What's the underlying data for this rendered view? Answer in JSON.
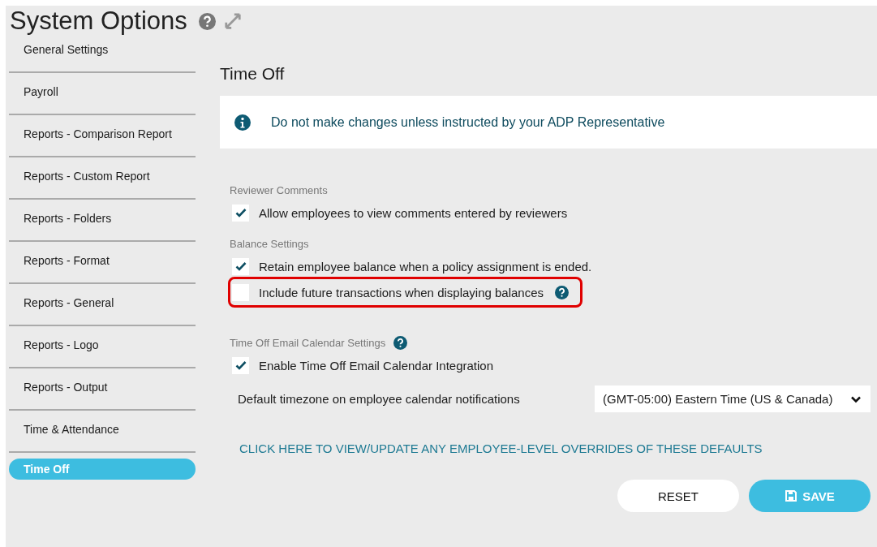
{
  "title": "System Options",
  "sidebar": {
    "items": [
      {
        "label": "General Settings",
        "selected": false
      },
      {
        "label": "Payroll",
        "selected": false
      },
      {
        "label": "Reports - Comparison Report",
        "selected": false
      },
      {
        "label": "Reports - Custom Report",
        "selected": false
      },
      {
        "label": "Reports - Folders",
        "selected": false
      },
      {
        "label": "Reports - Format",
        "selected": false
      },
      {
        "label": "Reports - General",
        "selected": false
      },
      {
        "label": "Reports - Logo",
        "selected": false
      },
      {
        "label": "Reports - Output",
        "selected": false
      },
      {
        "label": "Time & Attendance",
        "selected": false
      },
      {
        "label": "Time Off",
        "selected": true
      }
    ]
  },
  "heading": "Time Off",
  "notice": "Do not make changes unless instructed by your ADP Representative",
  "sections": [
    {
      "title": "Reviewer Comments",
      "help": false,
      "options": [
        {
          "label": "Allow employees to view comments entered by reviewers",
          "checked": true,
          "highlighted": false
        }
      ]
    },
    {
      "title": "Balance Settings",
      "help": false,
      "options": [
        {
          "label": "Retain employee balance when a policy assignment is ended.",
          "checked": true,
          "highlighted": false
        },
        {
          "label": "Include future transactions when displaying balances",
          "checked": false,
          "highlighted": true,
          "help": true
        }
      ]
    },
    {
      "title": "Time Off Email Calendar Settings",
      "help": true,
      "options": [
        {
          "label": "Enable Time Off Email Calendar Integration",
          "checked": true,
          "highlighted": false
        }
      ]
    }
  ],
  "timezone": {
    "label": "Default timezone on employee calendar notifications",
    "value": "(GMT-05:00) Eastern Time (US & Canada)"
  },
  "override_link": "CLICK HERE TO VIEW/UPDATE ANY EMPLOYEE-LEVEL OVERRIDES OF THESE DEFAULTS",
  "buttons": {
    "reset": "RESET",
    "save": "SAVE"
  }
}
